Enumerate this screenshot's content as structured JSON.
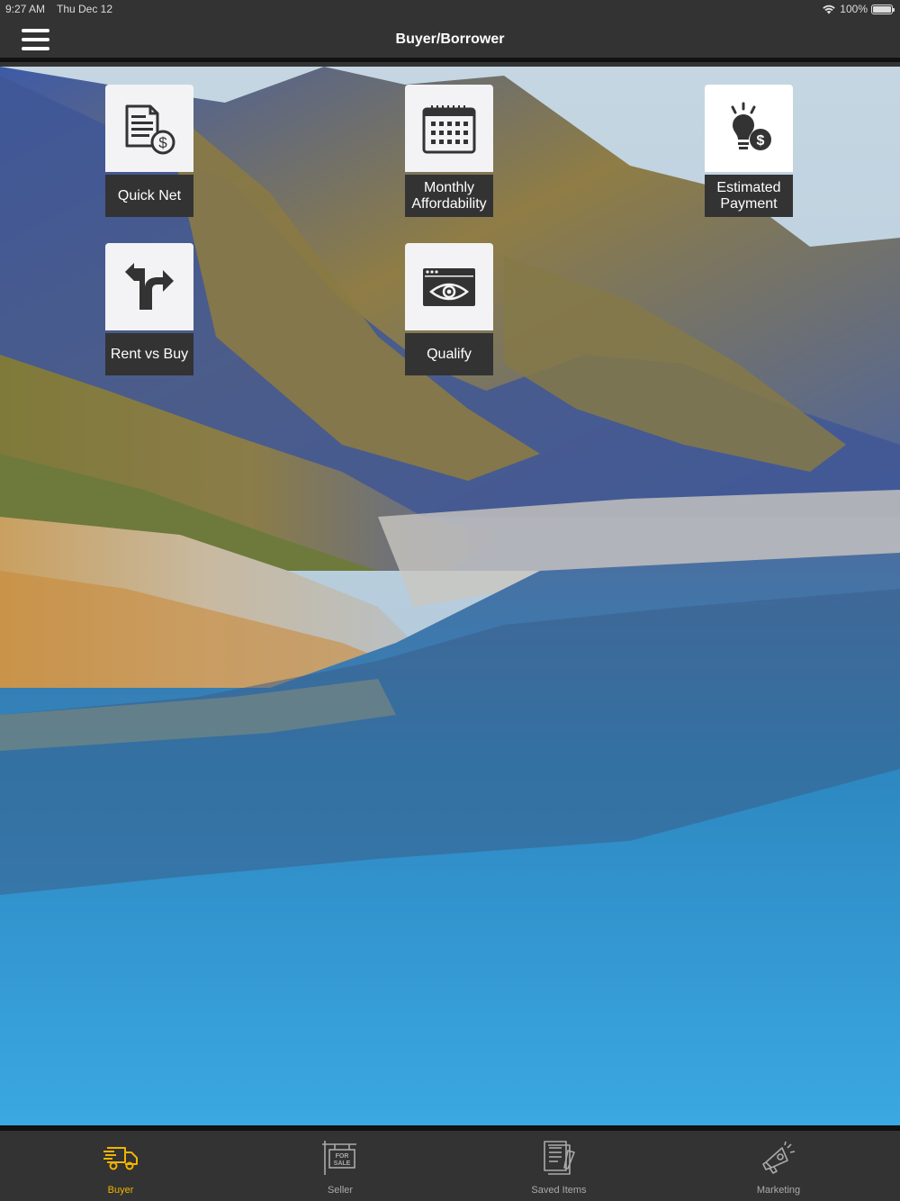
{
  "status": {
    "time": "9:27 AM",
    "date": "Thu Dec 12",
    "battery": "100%"
  },
  "nav": {
    "title": "Buyer/Borrower"
  },
  "tiles": [
    {
      "id": "quick-net",
      "label": "Quick Net",
      "icon": "document-dollar-icon"
    },
    {
      "id": "monthly-affordability",
      "label": "Monthly Affordability",
      "icon": "calendar-icon"
    },
    {
      "id": "estimated-payment",
      "label": "Estimated Payment",
      "icon": "lightbulb-dollar-icon"
    },
    {
      "id": "rent-vs-buy",
      "label": "Rent vs Buy",
      "icon": "split-arrow-icon"
    },
    {
      "id": "qualify",
      "label": "Qualify",
      "icon": "eye-window-icon"
    }
  ],
  "tabs": [
    {
      "label": "Buyer",
      "icon": "truck-icon",
      "active": true
    },
    {
      "label": "Seller",
      "icon": "for-sale-sign-icon",
      "active": false
    },
    {
      "label": "Saved Items",
      "icon": "documents-icon",
      "active": false
    },
    {
      "label": "Marketing",
      "icon": "megaphone-icon",
      "active": false
    }
  ],
  "colors": {
    "bar": "#333333",
    "accent": "#f0b400",
    "tile_bg": "#f3f3f5",
    "icon": "#333333"
  }
}
